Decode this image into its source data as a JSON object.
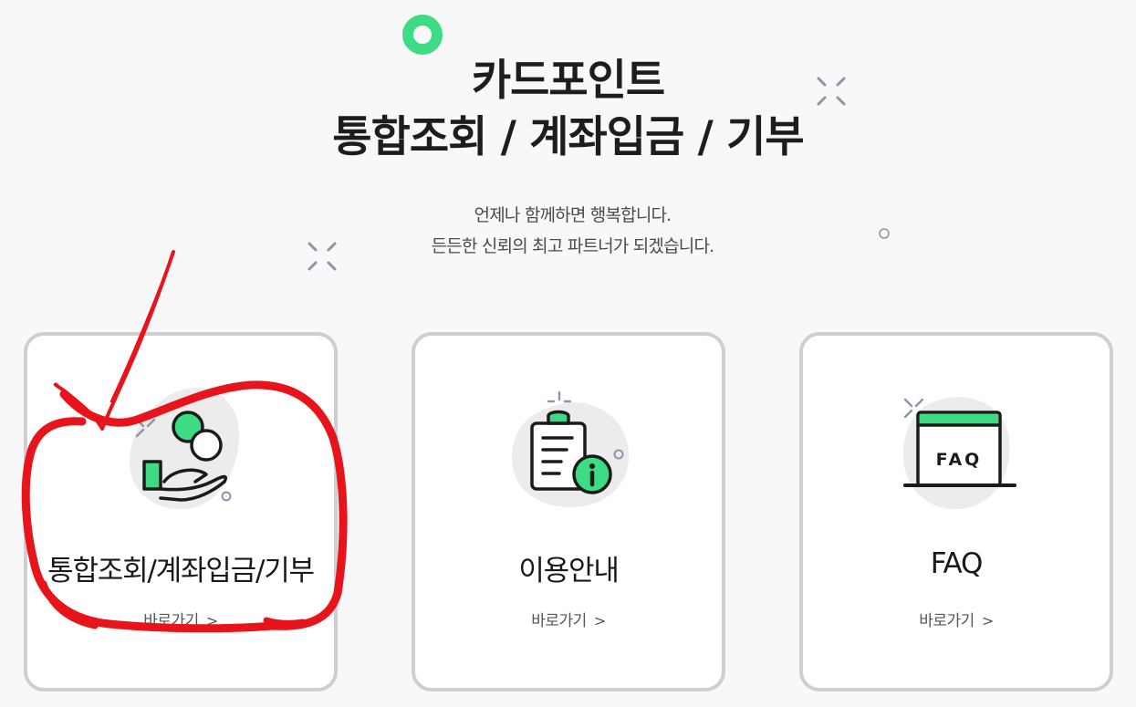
{
  "hero": {
    "title_line1": "카드포인트",
    "title_line2": "통합조회 / 계좌입금 / 기부",
    "subtitle_line1": "언제나 함께하면 행복합니다.",
    "subtitle_line2": "든든한 신뢰의 최고 파트너가 되겠습니다."
  },
  "cards": [
    {
      "title": "통합조회/계좌입금/기부",
      "link": "바로가기",
      "icon": "hand-coins-icon"
    },
    {
      "title": "이용안내",
      "link": "바로가기",
      "icon": "clipboard-info-icon"
    },
    {
      "title": "FAQ",
      "link": "바로가기",
      "icon": "faq-screen-icon",
      "icon_text": "FAQ"
    }
  ],
  "colors": {
    "accent_green": "#3ddc84",
    "annotation_red": "#e8141c",
    "card_border": "#cfcfcf"
  }
}
